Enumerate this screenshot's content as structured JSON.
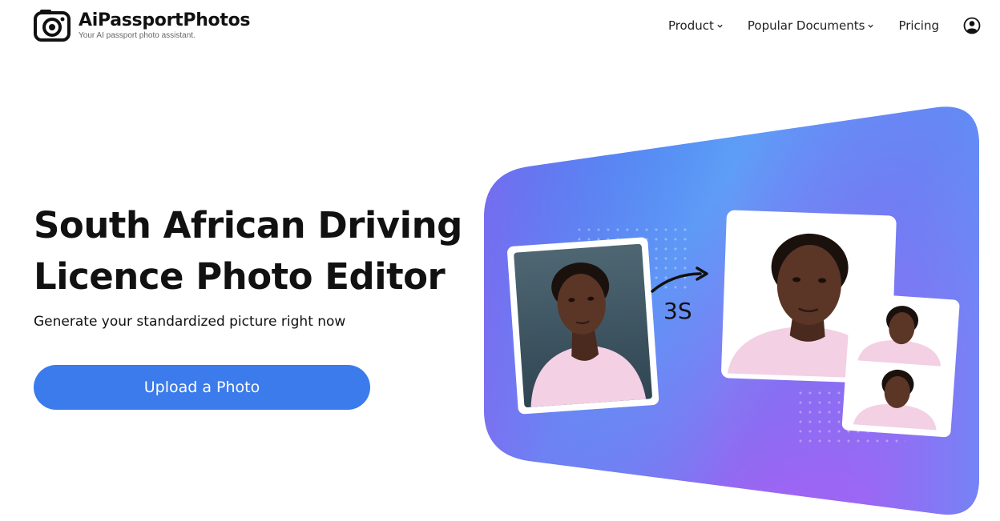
{
  "brand": {
    "name": "AiPassportPhotos",
    "tagline": "Your AI passport photo assistant."
  },
  "nav": {
    "product": "Product",
    "popular_documents": "Popular Documents",
    "pricing": "Pricing"
  },
  "hero": {
    "title_line1": "South African Driving",
    "title_line2": "Licence Photo Editor",
    "subtitle": "Generate your standardized picture right now",
    "upload_label": "Upload a Photo",
    "speed_label": "3S"
  },
  "icons": {
    "logo": "camera-logo-icon",
    "chevron": "chevron-down-icon",
    "account": "user-account-icon",
    "arrow": "curved-arrow-icon"
  },
  "colors": {
    "accent": "#3b7bec",
    "gradient_blue": "#3e7ff0",
    "gradient_purple": "#c453f4",
    "shirt_pink": "#f3d0e4"
  }
}
